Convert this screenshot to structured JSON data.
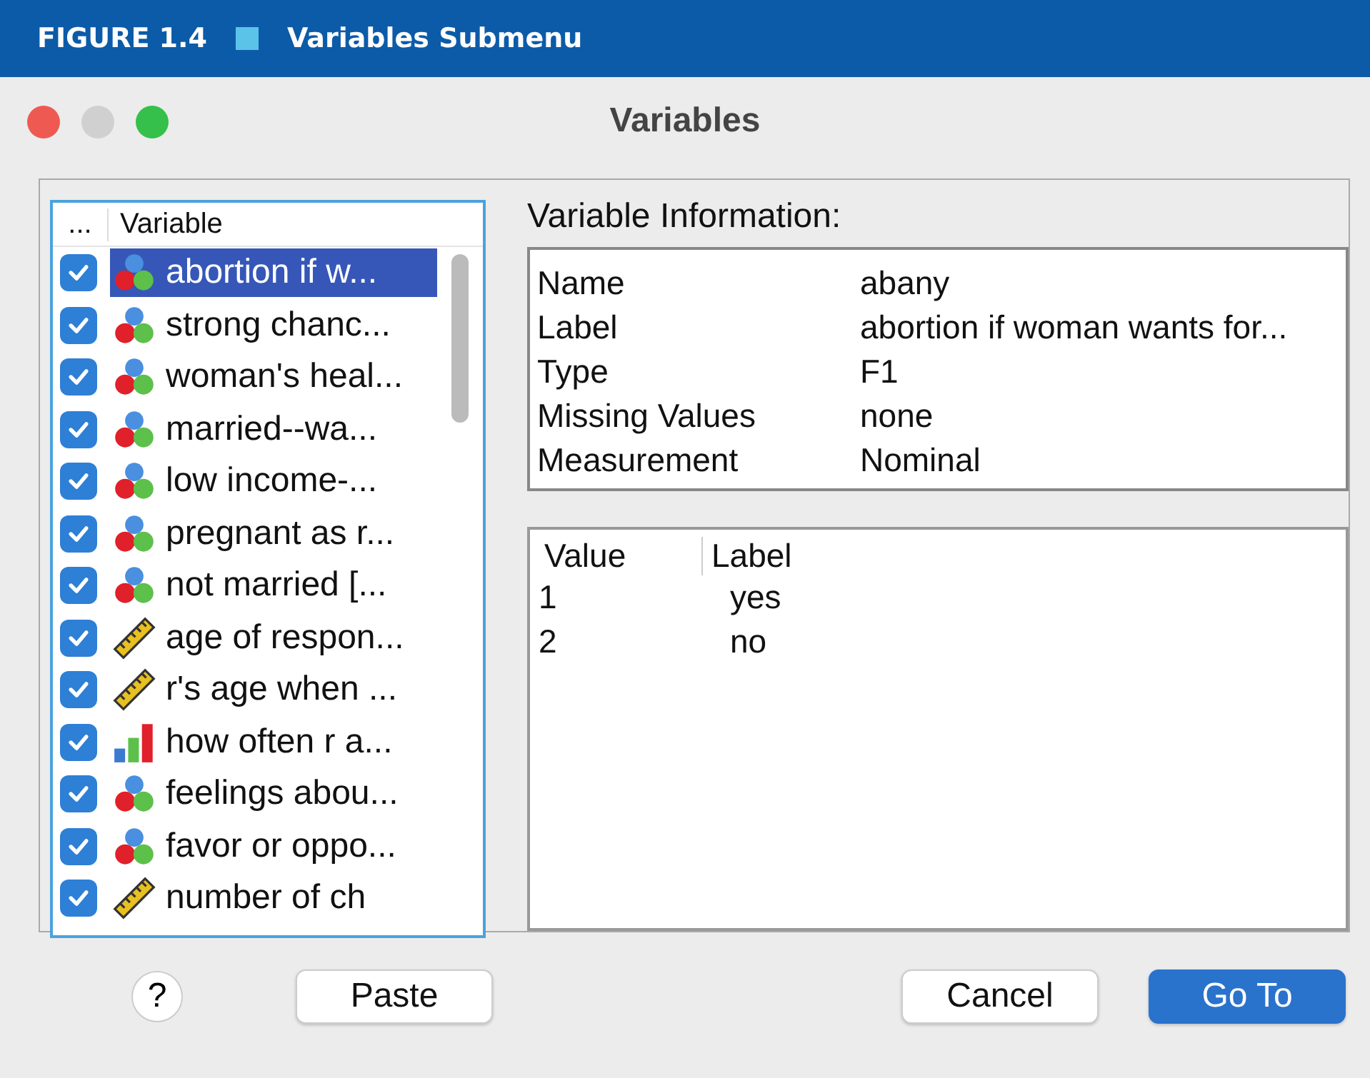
{
  "figure": {
    "number": "FIGURE 1.4",
    "title": "Variables Submenu"
  },
  "window": {
    "title": "Variables"
  },
  "variable_list": {
    "columns": [
      "...",
      "Variable"
    ],
    "rows": [
      {
        "checked": true,
        "kind": "nominal",
        "label": "abortion if w...",
        "selected": true
      },
      {
        "checked": true,
        "kind": "nominal",
        "label": "strong chanc...",
        "selected": false
      },
      {
        "checked": true,
        "kind": "nominal",
        "label": "woman's heal...",
        "selected": false
      },
      {
        "checked": true,
        "kind": "nominal",
        "label": "married--wa...",
        "selected": false
      },
      {
        "checked": true,
        "kind": "nominal",
        "label": "low income-...",
        "selected": false
      },
      {
        "checked": true,
        "kind": "nominal",
        "label": "pregnant as r...",
        "selected": false
      },
      {
        "checked": true,
        "kind": "nominal",
        "label": "not married [...",
        "selected": false
      },
      {
        "checked": true,
        "kind": "scale",
        "label": "age of respon...",
        "selected": false
      },
      {
        "checked": true,
        "kind": "scale",
        "label": "r's age when ...",
        "selected": false
      },
      {
        "checked": true,
        "kind": "ordinal",
        "label": "how often r a...",
        "selected": false
      },
      {
        "checked": true,
        "kind": "nominal",
        "label": "feelings abou...",
        "selected": false
      },
      {
        "checked": true,
        "kind": "nominal",
        "label": "favor or oppo...",
        "selected": false
      },
      {
        "checked": true,
        "kind": "scale",
        "label": "number of ch",
        "selected": false
      }
    ]
  },
  "variable_information": {
    "heading": "Variable Information:",
    "fields": [
      {
        "name": "Name",
        "value": "abany"
      },
      {
        "name": "Label",
        "value": "abortion if woman wants for..."
      },
      {
        "name": "Type",
        "value": "F1"
      },
      {
        "name": "Missing Values",
        "value": "none"
      },
      {
        "name": "Measurement",
        "value": "Nominal"
      }
    ]
  },
  "value_labels": {
    "columns": [
      "Value",
      "Label"
    ],
    "rows": [
      {
        "value": "1",
        "label": "yes"
      },
      {
        "value": "2",
        "label": "no"
      }
    ]
  },
  "buttons": {
    "help": "?",
    "paste": "Paste",
    "cancel": "Cancel",
    "go_to": "Go To"
  }
}
